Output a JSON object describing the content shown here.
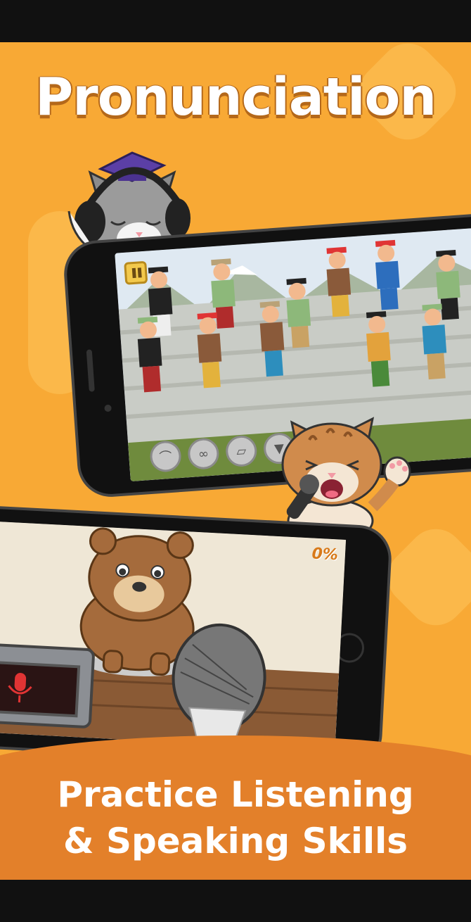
{
  "title": "Pronunciation",
  "subtitle": {
    "line1": "Practice Listening",
    "line2": "& Speaking Skills"
  },
  "colors": {
    "background": "#f8a935",
    "band": "#e3802a",
    "title_shadow": "#b4681a",
    "text": "#ffffff"
  },
  "game1": {
    "pause_icon": "pause-icon",
    "toolbar": [
      "hat-icon",
      "glasses-icon",
      "shoe-icon",
      "shirt-icon",
      "pants-icon"
    ]
  },
  "game2": {
    "pause_icon": "pause-icon",
    "progress_label": "0%",
    "record_icon": "microphone-icon"
  }
}
